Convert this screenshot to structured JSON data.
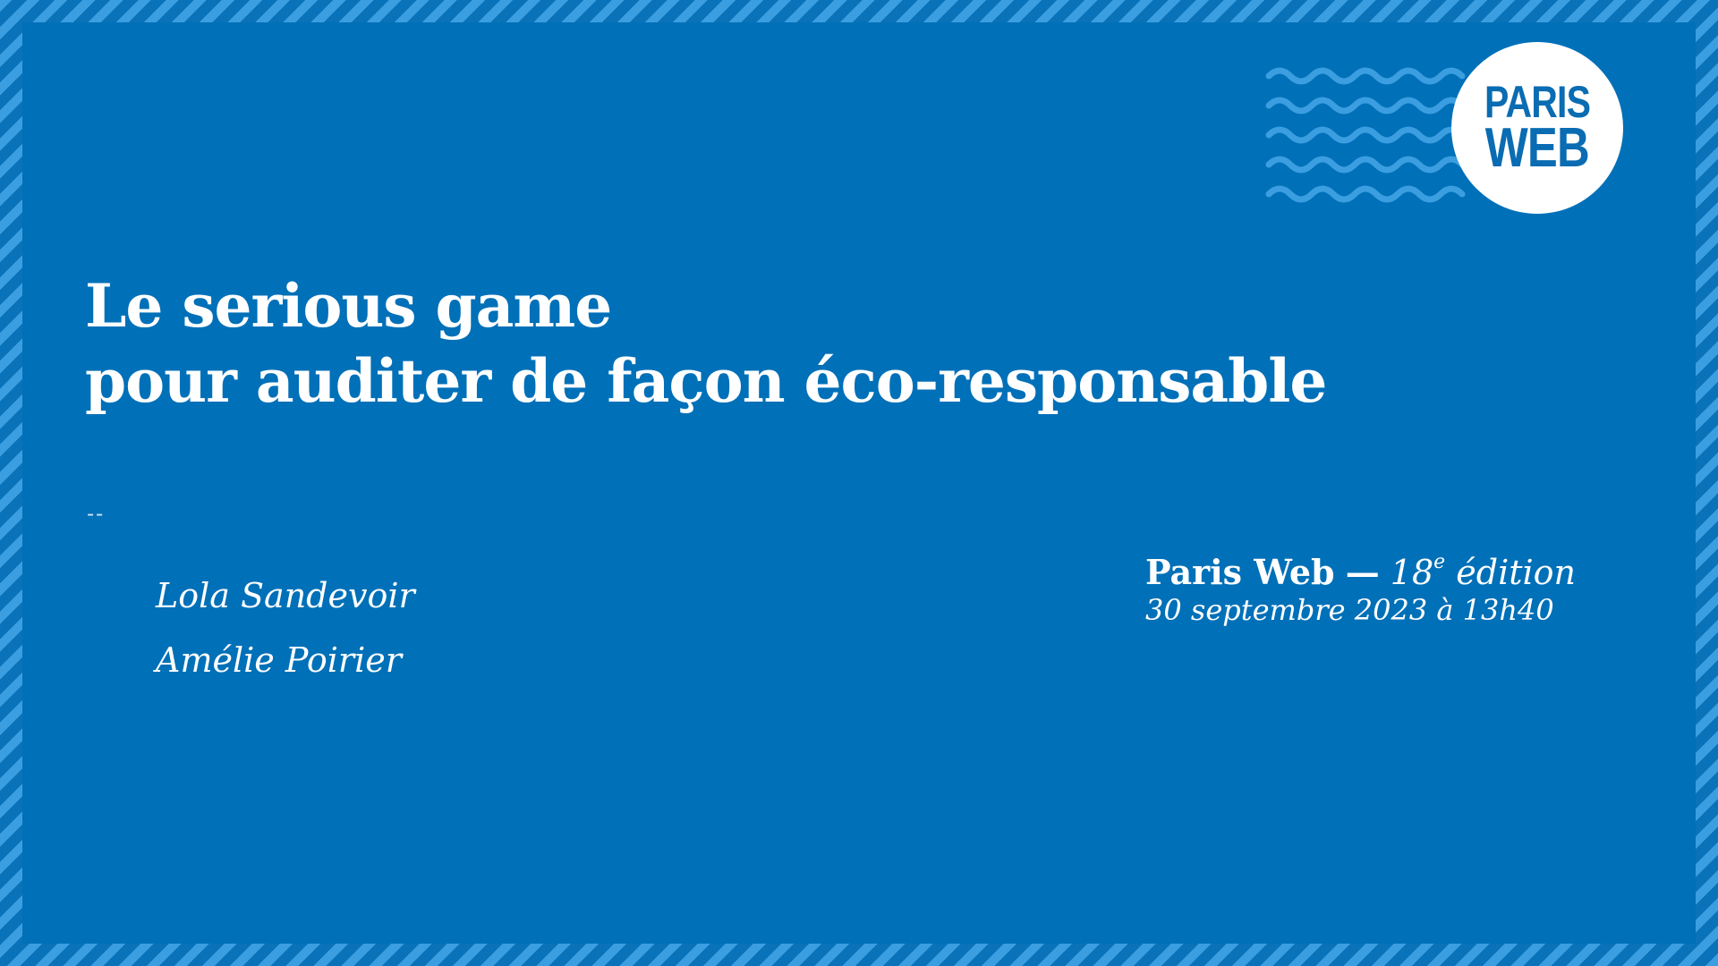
{
  "title": {
    "line1": "Le serious game",
    "line2": "pour auditer de façon éco-responsable"
  },
  "separator": "--",
  "authors": [
    "Lola Sandevoir",
    "Amélie Poirier"
  ],
  "event": {
    "name": "Paris Web",
    "dash": "—",
    "edition_number": "18",
    "edition_suffix": "e",
    "edition_word": "édition",
    "date": "30 septembre 2023 à 13h40"
  },
  "logo": {
    "line1": "PARIS",
    "line2": "WEB"
  },
  "colors": {
    "background": "#0070b8",
    "stripe": "#3b9ee0",
    "waves": "#3b9ee0",
    "text": "#ffffff",
    "logo_text": "#0a6cb2"
  },
  "icons": {
    "waves": "waves-decoration-icon",
    "logo": "paris-web-logo"
  }
}
